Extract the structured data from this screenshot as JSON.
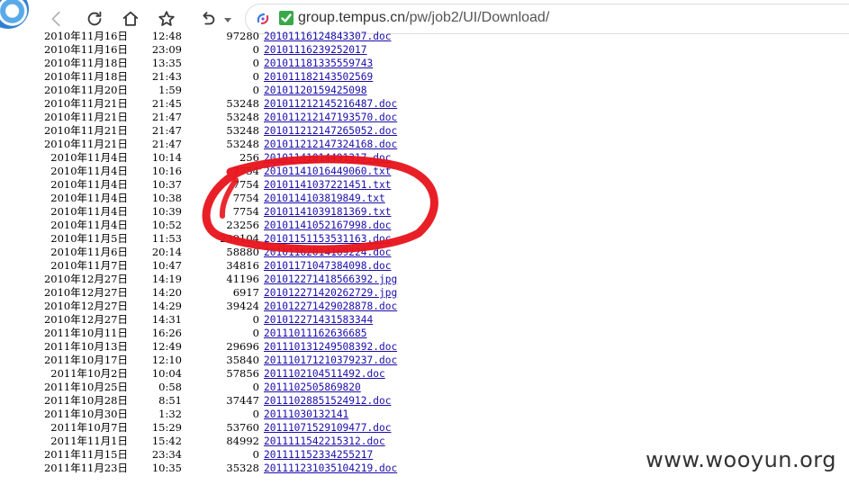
{
  "browser": {
    "url_host": "group.tempus.cn",
    "url_path": "/pw/job2/UI/Download/"
  },
  "listing": {
    "rows": [
      {
        "date": "2010年11月16日",
        "time": "12:48",
        "size": "97280",
        "name": "20101116124843307.doc"
      },
      {
        "date": "2010年11月16日",
        "time": "23:09",
        "size": "0",
        "name": "2010111623925201​7"
      },
      {
        "date": "2010年11月18日",
        "time": "13:35",
        "size": "0",
        "name": "2010111813355597​43"
      },
      {
        "date": "2010年11月18日",
        "time": "21:43",
        "size": "0",
        "name": "201011182143502569"
      },
      {
        "date": "2010年11月20日",
        "time": "1:59",
        "size": "0",
        "name": "20101120159425098"
      },
      {
        "date": "2010年11月21日",
        "time": "21:45",
        "size": "53248",
        "name": "201011212145216487.doc"
      },
      {
        "date": "2010年11月21日",
        "time": "21:47",
        "size": "53248",
        "name": "201011212147193570.doc"
      },
      {
        "date": "2010年11月21日",
        "time": "21:47",
        "size": "53248",
        "name": "201011212147265052.doc"
      },
      {
        "date": "2010年11月21日",
        "time": "21:47",
        "size": "53248",
        "name": "201011212147324168.doc"
      },
      {
        "date": "2010年11月4日",
        "time": "10:14",
        "size": "256",
        "name": "20101141014491317.doc"
      },
      {
        "date": "2010年11月4日",
        "time": "10:16",
        "size": "7754",
        "name": "20101141016449060.txt"
      },
      {
        "date": "2010年11月4日",
        "time": "10:37",
        "size": "7754",
        "name": "20101141037221451.txt"
      },
      {
        "date": "2010年11月4日",
        "time": "10:38",
        "size": "7754",
        "name": "2010114103819849.txt"
      },
      {
        "date": "2010年11月4日",
        "time": "10:39",
        "size": "7754",
        "name": "20101141039181369.txt"
      },
      {
        "date": "2010年11月4日",
        "time": "10:52",
        "size": "23256",
        "name": "20101141052167998.doc"
      },
      {
        "date": "2010年11月5日",
        "time": "11:53",
        "size": "239104",
        "name": "20101151153531163.doc"
      },
      {
        "date": "2010年11月6日",
        "time": "20:14",
        "size": "58880",
        "name": "20101162014169224.doc"
      },
      {
        "date": "2010年11月7日",
        "time": "10:47",
        "size": "34816",
        "name": "20101171047384098.doc"
      },
      {
        "date": "2010年12月27日",
        "time": "14:19",
        "size": "41196",
        "name": "201012271418566392.jpg"
      },
      {
        "date": "2010年12月27日",
        "time": "14:20",
        "size": "6917",
        "name": "201012271420262729.jpg"
      },
      {
        "date": "2010年12月27日",
        "time": "14:29",
        "size": "39424",
        "name": "201012271429028878.doc"
      },
      {
        "date": "2010年12月27日",
        "time": "14:31",
        "size": "0",
        "name": "201012271431583344"
      },
      {
        "date": "2011年10月11日",
        "time": "16:26",
        "size": "0",
        "name": "201110111626366​85"
      },
      {
        "date": "2011年10月13日",
        "time": "12:49",
        "size": "29696",
        "name": "201110131249508392.doc"
      },
      {
        "date": "2011年10月17日",
        "time": "12:10",
        "size": "35840",
        "name": "201110171210379237.doc"
      },
      {
        "date": "2011年10月2日",
        "time": "10:04",
        "size": "57856",
        "name": "20111021045114​92.doc"
      },
      {
        "date": "2011年10月25日",
        "time": "0:58",
        "size": "0",
        "name": "2011102505869820"
      },
      {
        "date": "2011年10月28日",
        "time": "8:51",
        "size": "37447",
        "name": "20111028851524912.doc"
      },
      {
        "date": "2011年10月30日",
        "time": "1:32",
        "size": "0",
        "name": "2011103013214​1"
      },
      {
        "date": "2011年10月7日",
        "time": "15:29",
        "size": "53760",
        "name": "20111071529109477.doc"
      },
      {
        "date": "2011年11月1日",
        "time": "15:42",
        "size": "84992",
        "name": "20111115422153​12.doc"
      },
      {
        "date": "2011年11月15日",
        "time": "23:34",
        "size": "0",
        "name": "201111152334255217"
      },
      {
        "date": "2011年11月23日",
        "time": "10:35",
        "size": "35328",
        "name": "201111231035104219.doc"
      }
    ]
  },
  "watermark": "www.wooyun.org",
  "colors": {
    "link": "#1a0dab",
    "annotation": "#e8131b",
    "secure": "#3aa84a"
  }
}
